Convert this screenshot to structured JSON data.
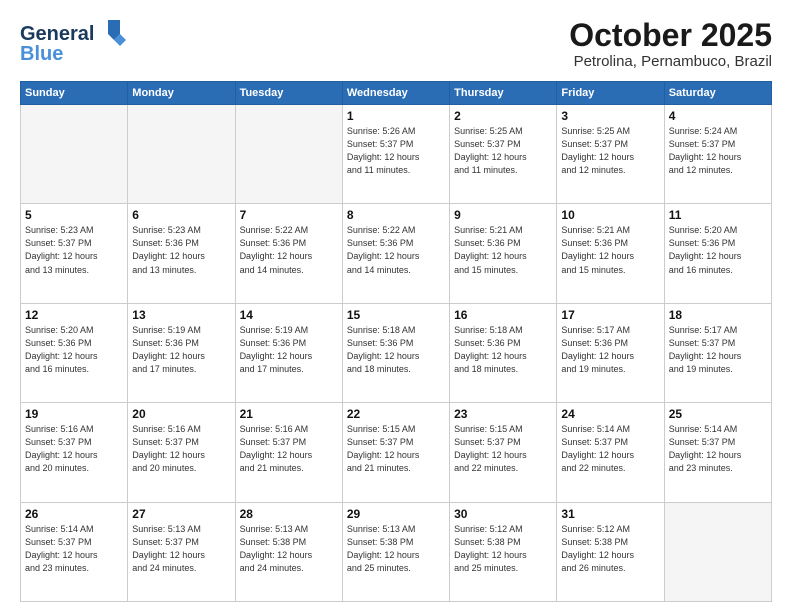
{
  "header": {
    "logo_general": "General",
    "logo_blue": "Blue",
    "month": "October 2025",
    "location": "Petrolina, Pernambuco, Brazil"
  },
  "weekdays": [
    "Sunday",
    "Monday",
    "Tuesday",
    "Wednesday",
    "Thursday",
    "Friday",
    "Saturday"
  ],
  "weeks": [
    [
      {
        "day": "",
        "info": ""
      },
      {
        "day": "",
        "info": ""
      },
      {
        "day": "",
        "info": ""
      },
      {
        "day": "1",
        "info": "Sunrise: 5:26 AM\nSunset: 5:37 PM\nDaylight: 12 hours\nand 11 minutes."
      },
      {
        "day": "2",
        "info": "Sunrise: 5:25 AM\nSunset: 5:37 PM\nDaylight: 12 hours\nand 11 minutes."
      },
      {
        "day": "3",
        "info": "Sunrise: 5:25 AM\nSunset: 5:37 PM\nDaylight: 12 hours\nand 12 minutes."
      },
      {
        "day": "4",
        "info": "Sunrise: 5:24 AM\nSunset: 5:37 PM\nDaylight: 12 hours\nand 12 minutes."
      }
    ],
    [
      {
        "day": "5",
        "info": "Sunrise: 5:23 AM\nSunset: 5:37 PM\nDaylight: 12 hours\nand 13 minutes."
      },
      {
        "day": "6",
        "info": "Sunrise: 5:23 AM\nSunset: 5:36 PM\nDaylight: 12 hours\nand 13 minutes."
      },
      {
        "day": "7",
        "info": "Sunrise: 5:22 AM\nSunset: 5:36 PM\nDaylight: 12 hours\nand 14 minutes."
      },
      {
        "day": "8",
        "info": "Sunrise: 5:22 AM\nSunset: 5:36 PM\nDaylight: 12 hours\nand 14 minutes."
      },
      {
        "day": "9",
        "info": "Sunrise: 5:21 AM\nSunset: 5:36 PM\nDaylight: 12 hours\nand 15 minutes."
      },
      {
        "day": "10",
        "info": "Sunrise: 5:21 AM\nSunset: 5:36 PM\nDaylight: 12 hours\nand 15 minutes."
      },
      {
        "day": "11",
        "info": "Sunrise: 5:20 AM\nSunset: 5:36 PM\nDaylight: 12 hours\nand 16 minutes."
      }
    ],
    [
      {
        "day": "12",
        "info": "Sunrise: 5:20 AM\nSunset: 5:36 PM\nDaylight: 12 hours\nand 16 minutes."
      },
      {
        "day": "13",
        "info": "Sunrise: 5:19 AM\nSunset: 5:36 PM\nDaylight: 12 hours\nand 17 minutes."
      },
      {
        "day": "14",
        "info": "Sunrise: 5:19 AM\nSunset: 5:36 PM\nDaylight: 12 hours\nand 17 minutes."
      },
      {
        "day": "15",
        "info": "Sunrise: 5:18 AM\nSunset: 5:36 PM\nDaylight: 12 hours\nand 18 minutes."
      },
      {
        "day": "16",
        "info": "Sunrise: 5:18 AM\nSunset: 5:36 PM\nDaylight: 12 hours\nand 18 minutes."
      },
      {
        "day": "17",
        "info": "Sunrise: 5:17 AM\nSunset: 5:36 PM\nDaylight: 12 hours\nand 19 minutes."
      },
      {
        "day": "18",
        "info": "Sunrise: 5:17 AM\nSunset: 5:37 PM\nDaylight: 12 hours\nand 19 minutes."
      }
    ],
    [
      {
        "day": "19",
        "info": "Sunrise: 5:16 AM\nSunset: 5:37 PM\nDaylight: 12 hours\nand 20 minutes."
      },
      {
        "day": "20",
        "info": "Sunrise: 5:16 AM\nSunset: 5:37 PM\nDaylight: 12 hours\nand 20 minutes."
      },
      {
        "day": "21",
        "info": "Sunrise: 5:16 AM\nSunset: 5:37 PM\nDaylight: 12 hours\nand 21 minutes."
      },
      {
        "day": "22",
        "info": "Sunrise: 5:15 AM\nSunset: 5:37 PM\nDaylight: 12 hours\nand 21 minutes."
      },
      {
        "day": "23",
        "info": "Sunrise: 5:15 AM\nSunset: 5:37 PM\nDaylight: 12 hours\nand 22 minutes."
      },
      {
        "day": "24",
        "info": "Sunrise: 5:14 AM\nSunset: 5:37 PM\nDaylight: 12 hours\nand 22 minutes."
      },
      {
        "day": "25",
        "info": "Sunrise: 5:14 AM\nSunset: 5:37 PM\nDaylight: 12 hours\nand 23 minutes."
      }
    ],
    [
      {
        "day": "26",
        "info": "Sunrise: 5:14 AM\nSunset: 5:37 PM\nDaylight: 12 hours\nand 23 minutes."
      },
      {
        "day": "27",
        "info": "Sunrise: 5:13 AM\nSunset: 5:37 PM\nDaylight: 12 hours\nand 24 minutes."
      },
      {
        "day": "28",
        "info": "Sunrise: 5:13 AM\nSunset: 5:38 PM\nDaylight: 12 hours\nand 24 minutes."
      },
      {
        "day": "29",
        "info": "Sunrise: 5:13 AM\nSunset: 5:38 PM\nDaylight: 12 hours\nand 25 minutes."
      },
      {
        "day": "30",
        "info": "Sunrise: 5:12 AM\nSunset: 5:38 PM\nDaylight: 12 hours\nand 25 minutes."
      },
      {
        "day": "31",
        "info": "Sunrise: 5:12 AM\nSunset: 5:38 PM\nDaylight: 12 hours\nand 26 minutes."
      },
      {
        "day": "",
        "info": ""
      }
    ]
  ]
}
